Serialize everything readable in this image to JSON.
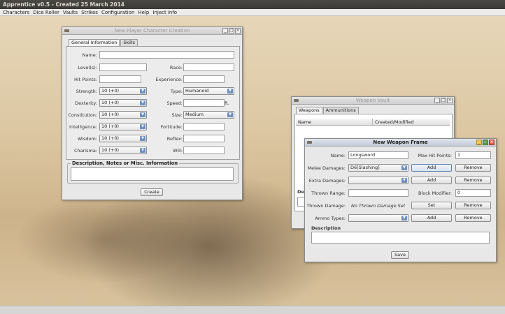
{
  "app": {
    "title": "Apprentice v0.5 - Created 25 March 2014",
    "menu": [
      "Characters",
      "Dice Roller",
      "Vaults",
      "Strikes",
      "Configuration",
      "Help",
      "Inject info"
    ]
  },
  "character_window": {
    "title": "New Player Character Creation",
    "tabs": [
      "General Information",
      "Skills"
    ],
    "labels": {
      "name": "Name:",
      "levels": "Level(s):",
      "race": "Race:",
      "hit_points": "Hit Points:",
      "experience": "Experience:",
      "strength": "Strength:",
      "type": "Type:",
      "dexterity": "Dexterity:",
      "speed": "Speed:",
      "speed_unit": "ft.",
      "constitution": "Constitution:",
      "size": "Size:",
      "intelligence": "Intelligence:",
      "fortitude": "Fortitude:",
      "wisdom": "Wisdom:",
      "reflex": "Reflex:",
      "charisma": "Charisma:",
      "will": "Will:"
    },
    "values": {
      "strength": "10 (+0)",
      "dexterity": "10 (+0)",
      "constitution": "10 (+0)",
      "intelligence": "10 (+0)",
      "wisdom": "10 (+0)",
      "charisma": "10 (+0)",
      "type": "Humanoid",
      "size": "Medium"
    },
    "description_title": "Description, Notes or Misc. Information",
    "create_button": "Create"
  },
  "weapon_vault": {
    "title": "Weapon Vault",
    "tabs": [
      "Weapons",
      "Ammunitions"
    ],
    "columns": [
      "Name",
      "Created/Modified"
    ],
    "partial_label": "De"
  },
  "weapon_frame": {
    "title": "New Weapon Frame",
    "labels": {
      "name": "Name:",
      "max_hp": "Max Hit Points:",
      "melee": "Melee Damages:",
      "extra": "Extra Damages:",
      "thrown_range": "Thrown Range:",
      "block": "Block Modifier:",
      "thrown_damage": "Thrown Damage:",
      "ammo": "Ammo Types:",
      "description": "Description"
    },
    "values": {
      "name": "Longsword",
      "max_hp": "1",
      "melee": "D6[Slashing]",
      "block": "0",
      "thrown_damage": "No Thrown Damage Set"
    },
    "buttons": {
      "add": "Add",
      "remove": "Remove",
      "set": "Set",
      "save": "Save"
    }
  }
}
